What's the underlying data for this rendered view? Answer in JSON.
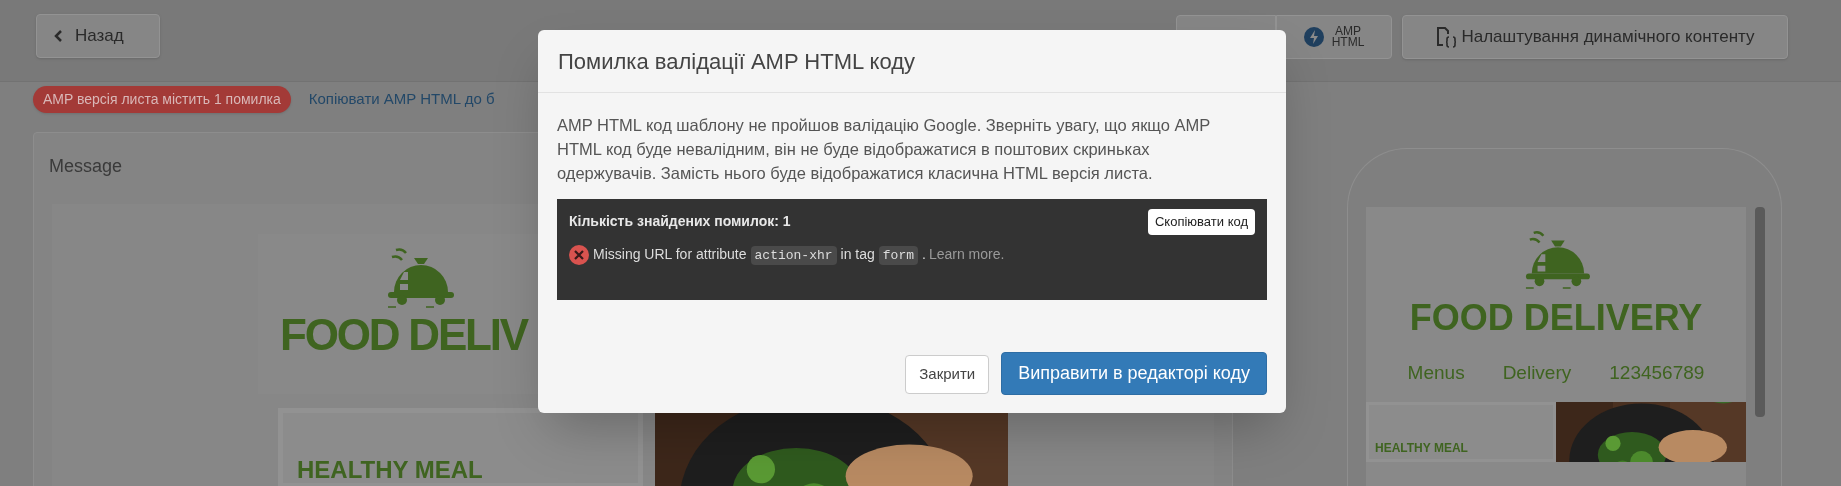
{
  "header": {
    "back_button": "Назад",
    "amp_button_lines": [
      "AMP",
      "HTML"
    ],
    "dynamic_content_button": "Налаштування динамічного контенту"
  },
  "status": {
    "error_badge": "AMP версія листа містить 1 помилка",
    "copy_link": "Копіювати AMP HTML до б"
  },
  "message_card": {
    "title": "Message",
    "brand": "FOOD DELIV",
    "headline": "HEALTHY MEAL"
  },
  "phone_preview": {
    "brand": "FOOD DELIVERY",
    "nav": [
      "Menus",
      "Delivery",
      "123456789"
    ],
    "headline": "HEALTHY MEAL"
  },
  "modal": {
    "title": "Помилка валідації AMP HTML коду",
    "description": "AMP HTML код шаблону не пройшов валідацію Google. Зверніть увагу, що якщо AMP HTML код буде невалідним, він не буде відображатися в поштових скриньках одержувачів. Замість нього буде відображатися класична HTML версія листа.",
    "errors_box": {
      "count_label": "Кількість знайдених помилок: 1",
      "copy_button": "Скопіювати код",
      "errors": [
        {
          "segments": [
            {
              "kind": "text",
              "text": "Missing URL for attribute"
            },
            {
              "kind": "code",
              "text": "action-xhr"
            },
            {
              "kind": "text",
              "text": "in tag"
            },
            {
              "kind": "code",
              "text": "form"
            },
            {
              "kind": "text",
              "text": "."
            },
            {
              "kind": "link",
              "text": "Learn more."
            }
          ]
        }
      ]
    },
    "buttons": {
      "close": "Закрити",
      "fix": "Виправити в редакторі коду"
    }
  }
}
